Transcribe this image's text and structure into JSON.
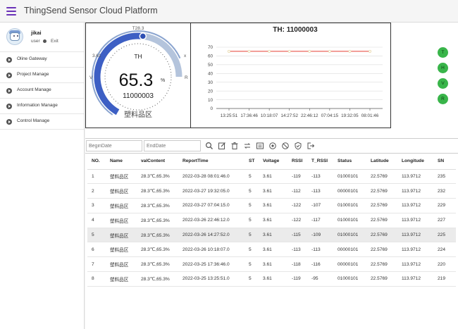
{
  "app": {
    "title": "ThingSend Sensor Cloud Platform"
  },
  "user": {
    "name": "jikai",
    "role": "user",
    "exit_label": "Exit"
  },
  "sidebar": {
    "items": [
      {
        "label": "Oline Gateway"
      },
      {
        "label": "Project Manage"
      },
      {
        "label": "Account Manage"
      },
      {
        "label": "Information Manage"
      },
      {
        "label": "Control Manage"
      }
    ]
  },
  "gauge": {
    "title": "TH",
    "value": "65.3",
    "unit": "%",
    "device_id": "11000003",
    "area": "塑料品区",
    "top_label": "T28.3",
    "left_label": "3.61",
    "v_label": "V",
    "r_label": "R",
    "x_label": "x",
    "level_fraction": 0.653
  },
  "chart_data": {
    "type": "line",
    "title": "TH: 11000003",
    "x": [
      "13:25:51",
      "17:36:46",
      "10:18:07",
      "14:27:52",
      "22:46:12",
      "07:04:15",
      "19:32:05",
      "08:01:46"
    ],
    "series": [
      {
        "values": [
          65.3,
          65.3,
          65.3,
          65.3,
          65.3,
          65.3,
          65.3,
          65.3
        ],
        "color": "#e8544a"
      }
    ],
    "yticks": [
      0,
      10,
      20,
      30,
      40,
      50,
      60,
      70
    ],
    "ylim": [
      0,
      70
    ],
    "grid": true
  },
  "status_lights": [
    {
      "label": "T",
      "color": "#39b54a"
    },
    {
      "label": "H",
      "color": "#39b54a"
    },
    {
      "label": "V",
      "color": "#39b54a"
    },
    {
      "label": "R",
      "color": "#39b54a"
    }
  ],
  "toolbar": {
    "begin_placeholder": "BeginDate",
    "end_placeholder": "EndDate",
    "icons": [
      "search-icon",
      "edit-icon",
      "delete-icon",
      "refresh-icon",
      "export-icon",
      "settings-icon",
      "block-icon",
      "shield-icon",
      "logout-icon"
    ]
  },
  "table": {
    "columns": [
      "NO.",
      "Name",
      "valContent",
      "ReportTime",
      "ST",
      "Voltage",
      "RSSI",
      "T_RSSI",
      "Status",
      "Latitude",
      "Longitude",
      "SN"
    ],
    "rows": [
      [
        "1",
        "塑料品区",
        "28.3℃,65.3%",
        "2022-03-28 08:01:46.0",
        "5",
        "3.61",
        "-119",
        "-113",
        "01000101",
        "22.5769",
        "113.9712",
        "235"
      ],
      [
        "2",
        "塑料品区",
        "28.3℃,65.3%",
        "2022-03-27 19:32:05.0",
        "5",
        "3.61",
        "-112",
        "-113",
        "00000101",
        "22.5769",
        "113.9712",
        "232"
      ],
      [
        "3",
        "塑料品区",
        "28.3℃,65.3%",
        "2022-03-27 07:04:15.0",
        "5",
        "3.61",
        "-122",
        "-107",
        "01000101",
        "22.5769",
        "113.9712",
        "229"
      ],
      [
        "4",
        "塑料品区",
        "28.3℃,65.3%",
        "2022-03-26 22:46:12.0",
        "5",
        "3.61",
        "-122",
        "-117",
        "01000101",
        "22.5769",
        "113.9712",
        "227"
      ],
      [
        "5",
        "塑料品区",
        "28.3℃,65.3%",
        "2022-03-26 14:27:52.0",
        "5",
        "3.61",
        "-115",
        "-109",
        "01000101",
        "22.5769",
        "113.9712",
        "225"
      ],
      [
        "6",
        "塑料品区",
        "28.3℃,65.3%",
        "2022-03-26 10:18:07.0",
        "5",
        "3.61",
        "-113",
        "-113",
        "00000101",
        "22.5769",
        "113.9712",
        "224"
      ],
      [
        "7",
        "塑料品区",
        "28.3℃,65.3%",
        "2022-03-25 17:36:46.0",
        "5",
        "3.61",
        "-118",
        "-116",
        "00000101",
        "22.5769",
        "113.9712",
        "220"
      ],
      [
        "8",
        "塑料品区",
        "28.3℃,65.3%",
        "2022-03-25 13:25:51.0",
        "5",
        "3.61",
        "-119",
        "-95",
        "01000101",
        "22.5769",
        "113.9712",
        "219"
      ]
    ],
    "selected_row": 4
  }
}
